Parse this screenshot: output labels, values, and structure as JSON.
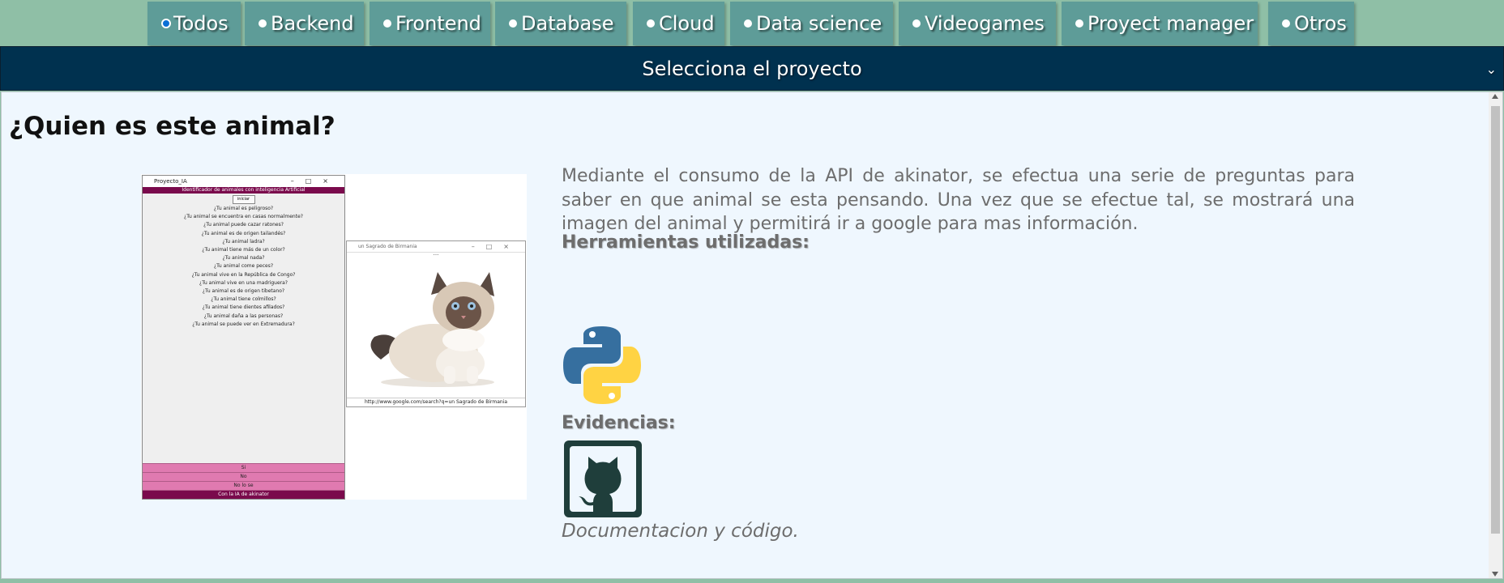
{
  "tabs": [
    {
      "label": "Todos",
      "selected": true
    },
    {
      "label": "Backend",
      "selected": false
    },
    {
      "label": "Frontend",
      "selected": false
    },
    {
      "label": "Database",
      "selected": false
    },
    {
      "label": "Cloud",
      "selected": false
    },
    {
      "label": "Data science",
      "selected": false
    },
    {
      "label": "Videogames",
      "selected": false
    },
    {
      "label": "Proyect manager",
      "selected": false
    },
    {
      "label": "Otros",
      "selected": false
    }
  ],
  "project_select": {
    "value": "Selecciona el proyecto"
  },
  "project": {
    "title": "¿Quien es este animal?",
    "description": "Mediante el consumo de la API de akinator, se efectua una serie de preguntas para saber en que animal se esta pensando. Una vez que se efectue tal, se mostrará una imagen del animal y permitirá ir a google para mas información.",
    "tools_heading": "Herramientas utilizadas:",
    "evidence_heading": "Evidencias:",
    "doc_link": "Documentacion y código.",
    "screenshot": {
      "main_window_title": "Proyecto_IA",
      "header_bar": "Identificador de animales con inteligencia Artificial",
      "start_button": "iniciar",
      "questions": [
        "¿Tu animal es peligroso?",
        "¿Tu animal se encuentra en casas normalmente?",
        "¿Tu animal puede cazar ratones?",
        "¿Tu animal es de origen tailandés?",
        "¿Tu animal ladra?",
        "¿Tu animal tiene más de un color?",
        "¿Tu animal nada?",
        "¿Tu animal come peces?",
        "¿Tu animal vive en la República de Congo?",
        "¿Tu animal vive en una madriguera?",
        "¿Tu animal es de origen tibetano?",
        "¿Tu animal tiene colmillos?",
        "¿Tu animal tiene dientes afilados?",
        "¿Tu animal daña a las personas?",
        "¿Tu animal se puede ver en Extremadura?"
      ],
      "answers": [
        "Si",
        "No",
        "No lo se"
      ],
      "footer_bar": "Con la IA de akinator",
      "result_window_title": "un Sagrado de Birmania",
      "result_url": "http://www.google.com/search?q=un Sagrado de Birmania"
    }
  },
  "colors": {
    "page_background": "#8fbfa6",
    "tab_background": "#5e9c98",
    "select_background": "#00314f",
    "panel_background": "#eff7fe",
    "text_gray": "#6d6d6d",
    "python_blue": "#366f9f",
    "python_yellow": "#ffd343",
    "github_green": "#1f3e3b"
  },
  "icons": {
    "tools": [
      "python-logo-icon"
    ],
    "evidence": [
      "github-logo-icon"
    ]
  }
}
